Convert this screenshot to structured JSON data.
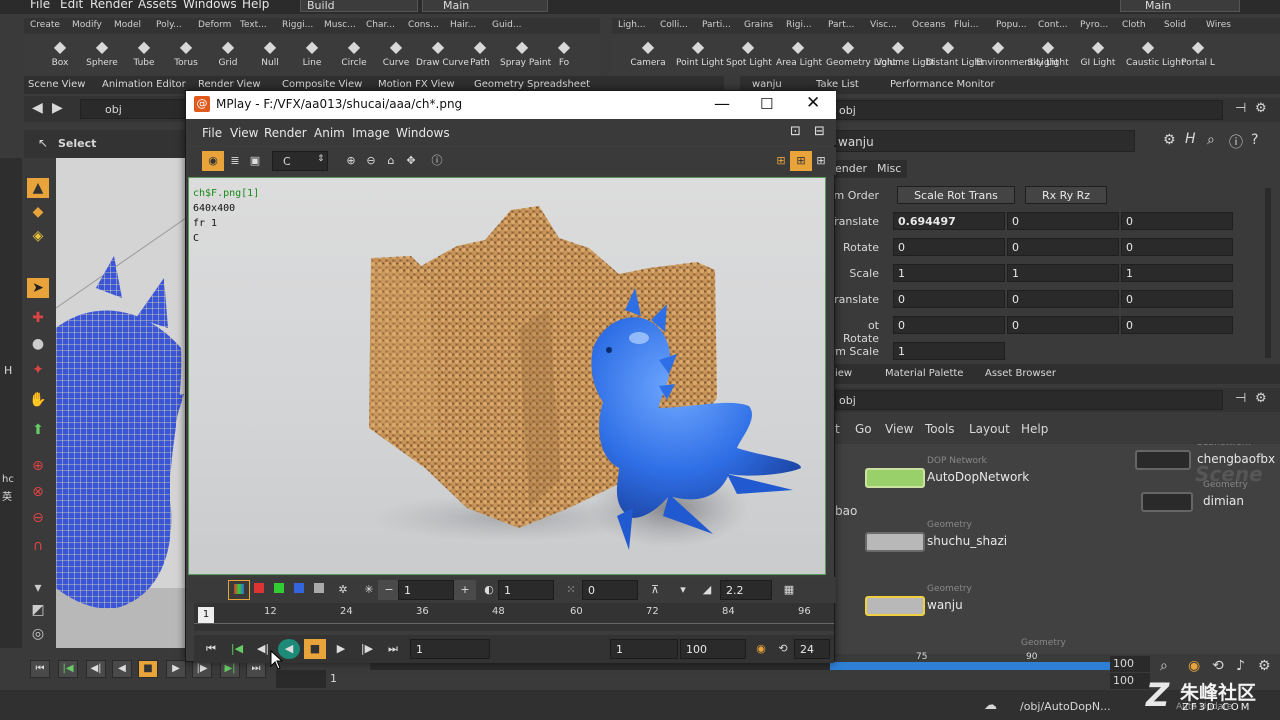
{
  "menubar": {
    "items": [
      "File",
      "Edit",
      "Render",
      "Assets",
      "Windows",
      "Help"
    ],
    "build": "Build",
    "main_left": "Main",
    "main_right": "Main"
  },
  "shelf_left": {
    "tabs": [
      "Create",
      "Modify",
      "Model",
      "Poly...",
      "Deform",
      "Text...",
      "Riggi...",
      "Musc...",
      "Char...",
      "Cons...",
      "Hair...",
      "Guid..."
    ],
    "tools": [
      {
        "label": "Box",
        "icon": "box-icon"
      },
      {
        "label": "Sphere",
        "icon": "sphere-icon"
      },
      {
        "label": "Tube",
        "icon": "tube-icon"
      },
      {
        "label": "Torus",
        "icon": "torus-icon"
      },
      {
        "label": "Grid",
        "icon": "grid-icon"
      },
      {
        "label": "Null",
        "icon": "null-icon"
      },
      {
        "label": "Line",
        "icon": "line-icon"
      },
      {
        "label": "Circle",
        "icon": "circle-icon"
      },
      {
        "label": "Curve",
        "icon": "curve-icon"
      },
      {
        "label": "Draw Curve",
        "icon": "draw-curve-icon"
      },
      {
        "label": "Path",
        "icon": "path-icon"
      },
      {
        "label": "Spray Paint",
        "icon": "spray-paint-icon"
      },
      {
        "label": "Fo",
        "icon": "font-icon"
      }
    ]
  },
  "shelf_right": {
    "tabs": [
      "Ligh...",
      "Colli...",
      "Parti...",
      "Grains",
      "Rigi...",
      "Part...",
      "Visc...",
      "Oceans",
      "Flui...",
      "Popu...",
      "Cont...",
      "Pyro...",
      "Cloth",
      "Solid",
      "Wires"
    ],
    "tools": [
      {
        "label": "Camera",
        "icon": "camera-icon"
      },
      {
        "label": "Point Light",
        "icon": "point-light-icon"
      },
      {
        "label": "Spot Light",
        "icon": "spot-light-icon"
      },
      {
        "label": "Area Light",
        "icon": "area-light-icon"
      },
      {
        "label": "Geometry Light",
        "icon": "geometry-light-icon"
      },
      {
        "label": "Volume Light",
        "icon": "volume-light-icon"
      },
      {
        "label": "Distant Light",
        "icon": "distant-light-icon"
      },
      {
        "label": "Environment Light",
        "icon": "environment-light-icon"
      },
      {
        "label": "Sky Light",
        "icon": "sky-light-icon"
      },
      {
        "label": "GI Light",
        "icon": "gi-light-icon"
      },
      {
        "label": "Caustic Light",
        "icon": "caustic-light-icon"
      },
      {
        "label": "Portal L",
        "icon": "portal-light-icon"
      }
    ]
  },
  "pane_tabs_left": [
    "Scene View",
    "Animation Editor",
    "Render View",
    "Composite View",
    "Motion FX View",
    "Geometry Spreadsheet"
  ],
  "pane_tabs_right": [
    "wanju",
    "Take List",
    "Performance Monitor"
  ],
  "path_left": "obj",
  "path_right": "obj",
  "viewport": {
    "tool": "Select"
  },
  "params": {
    "node_name": "wanju",
    "tabs": [
      "ender",
      "Misc"
    ],
    "rows": [
      {
        "label": "rm Order",
        "values": [
          "Scale Rot Trans",
          "Rx Ry Rz"
        ]
      },
      {
        "label": "Translate",
        "values": [
          "0.694497",
          "0",
          "0"
        ]
      },
      {
        "label": "Rotate",
        "values": [
          "0",
          "0",
          "0"
        ]
      },
      {
        "label": "Scale",
        "values": [
          "1",
          "1",
          "1"
        ]
      },
      {
        "label": "ranslate",
        "values": [
          "0",
          "0",
          "0"
        ]
      },
      {
        "label": "ot Rotate",
        "values": [
          "0",
          "0",
          "0"
        ]
      },
      {
        "label": "rm Scale",
        "values": [
          "1"
        ]
      }
    ]
  },
  "net_tabs": [
    "iew",
    "Material Palette",
    "Asset Browser"
  ],
  "net_path": "obj",
  "net_menu": [
    "t",
    "Go",
    "View",
    "Tools",
    "Layout",
    "Help"
  ],
  "nodes": [
    {
      "type": "DOP Network",
      "name": "AutoDopNetwork"
    },
    {
      "type": "Geometry",
      "name": "shuchu_shazi"
    },
    {
      "type": "Geometry",
      "name": "wanju"
    },
    {
      "type": "Subnetwork",
      "name": "chengbaofbx"
    },
    {
      "type": "Geometry",
      "name": "dimian"
    },
    {
      "type": "Geometry",
      "name": ""
    }
  ],
  "net_watermark": "Scene",
  "net_side_text": "bao",
  "mplay": {
    "title": "MPlay - F:/VFX/aa013/shucai/aaa/ch*.png",
    "menu": [
      "File",
      "View",
      "Render",
      "Anim",
      "Image",
      "Windows"
    ],
    "channel": "C",
    "info": [
      "ch$F.png[1]",
      "640x400",
      "fr 1",
      "C"
    ],
    "controls": {
      "frame": "1",
      "gamma_frame": "1",
      "offset": "0",
      "gamma": "2.2"
    },
    "timeline_ticks": [
      "1",
      "12",
      "24",
      "36",
      "48",
      "60",
      "72",
      "84",
      "96"
    ],
    "play": {
      "current": "1",
      "start": "1",
      "end": "100",
      "fps": "24"
    }
  },
  "playbar": {
    "frame": "1",
    "end1": "100",
    "end2": "100",
    "ticks": [
      "75",
      "90"
    ],
    "auto_update": "Auto Update",
    "status_path": "/obj/AutoDopN..."
  },
  "watermark": {
    "text": "朱峰社区",
    "sub": "ZF3D.COM"
  },
  "left_edge": [
    "H",
    "hc",
    "英"
  ],
  "colors": {
    "accent": "#e8a33a",
    "green": "#5bb35b",
    "blue_dino": "#2f6fe6",
    "sand": "#c8975a"
  }
}
